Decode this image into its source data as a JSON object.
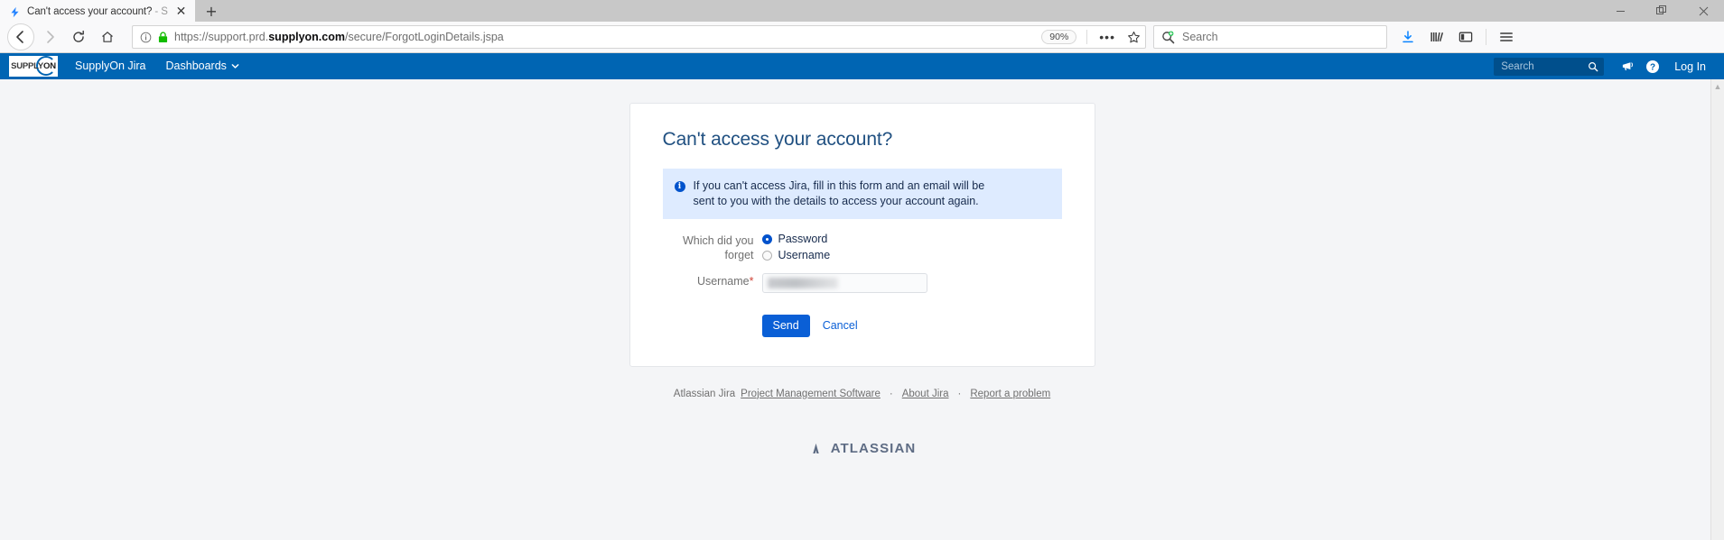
{
  "browser": {
    "tab": {
      "favicon": "jira-bolt-icon",
      "title": "Can't access your account?",
      "title_dim": " - Su",
      "close": "✕"
    },
    "new_tab": "+",
    "window_controls": {
      "minimize": "—",
      "restore": "❐",
      "close": "✕"
    },
    "nav": {
      "back": "←",
      "forward": "→",
      "reload": "⟳",
      "home": "⌂"
    },
    "url": {
      "info_icon": "page-info-icon",
      "lock_icon": "lock-icon",
      "prefix": "https://support.prd.",
      "domain": "supplyon.com",
      "path": "/secure/ForgotLoginDetails.jspa",
      "zoom_level": "90%",
      "more": "•••",
      "bookmark": "☆"
    },
    "search": {
      "placeholder": "Search",
      "icon": "search-icon"
    },
    "toolbar": {
      "downloads": "downloads-icon",
      "library": "library-icon",
      "sidebar": "sidebar-icon",
      "menu": "hamburger-menu-icon"
    }
  },
  "jira_nav": {
    "logo": {
      "text_light": "SUPPLY",
      "text_bold": "ON"
    },
    "links": [
      {
        "label": "SupplyOn Jira",
        "caret": ""
      },
      {
        "label": "Dashboards",
        "caret": "⌄"
      }
    ],
    "search_placeholder": "Search",
    "search_icon": "search-icon",
    "announcement_icon": "megaphone-icon",
    "help_icon": "help-icon",
    "help_glyph": "?",
    "login_label": "Log In"
  },
  "main": {
    "heading": "Can't access your account?",
    "info": {
      "icon": "info-icon",
      "glyph": "i",
      "text": "If you can't access Jira, fill in this form and an email will be sent to you with the details to access your account again."
    },
    "forget_label": "Which did you forget",
    "options": [
      {
        "label": "Password",
        "selected": true
      },
      {
        "label": "Username",
        "selected": false
      }
    ],
    "username_label": "Username",
    "required_mark": "*",
    "username_value": "",
    "username_placeholder": "",
    "send_label": "Send",
    "cancel_label": "Cancel"
  },
  "footer": {
    "prefix": "Atlassian Jira",
    "links": [
      "Project Management Software",
      "About Jira",
      "Report a problem"
    ],
    "separator": "·",
    "brand": "ATLASSIAN",
    "brand_icon": "atlassian-logo-icon"
  },
  "colors": {
    "jira_navbar": "#0065b3",
    "accent_blue": "#0a5fd6",
    "info_bg": "#deebff",
    "heading": "#205081",
    "page_bg": "#f4f5f7",
    "required": "#d04437"
  }
}
